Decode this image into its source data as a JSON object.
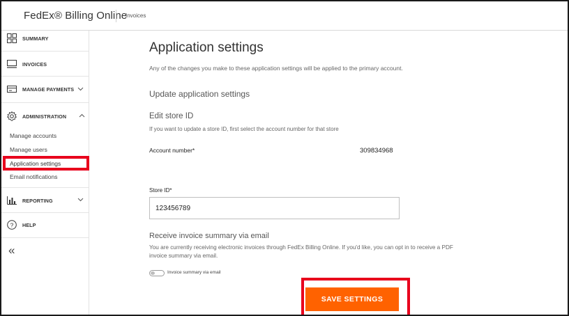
{
  "header": {
    "brand": "FedEx® Billing Online",
    "breadcrumb": "Invoices"
  },
  "sidebar": {
    "items": [
      {
        "label": "SUMMARY",
        "icon": "grid-icon"
      },
      {
        "label": "INVOICES",
        "icon": "invoice-icon"
      },
      {
        "label": "MANAGE PAYMENTS",
        "icon": "payment-card-icon"
      },
      {
        "label": "ADMINISTRATION",
        "icon": "gear-icon"
      },
      {
        "label": "REPORTING",
        "icon": "bar-chart-icon"
      },
      {
        "label": "HELP",
        "icon": "help-circle-icon"
      }
    ],
    "admin_sub": [
      "Manage accounts",
      "Manage users",
      "Application settings",
      "Email notifications"
    ],
    "collapse_glyph": "«"
  },
  "main": {
    "title": "Application settings",
    "intro": "Any of the changes you make to these application settings will be applied to the primary account.",
    "section_title": "Update application settings",
    "store_heading": "Edit store ID",
    "store_help": "If you want to update a store ID, first select the account number for that store",
    "account_label": "Account number*",
    "account_value": "309834968",
    "store_label": "Store ID*",
    "store_value": "123456789",
    "email_title": "Receive invoice summary via email",
    "email_body": "You are currently receiving electronic invoices through FedEx Billing Online. If you'd like, you can opt in to receive a PDF invoice summary via email.",
    "toggle_label": "Invoice summary via email",
    "toggle_on": false,
    "save_label": "SAVE SETTINGS"
  },
  "colors": {
    "accent": "#ff6200",
    "highlight": "#e8001c"
  }
}
